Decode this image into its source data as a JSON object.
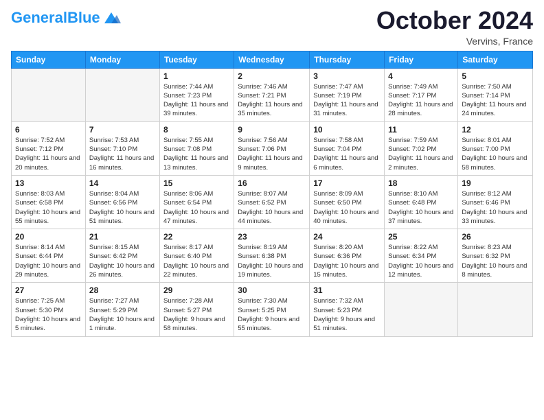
{
  "header": {
    "logo_text_general": "General",
    "logo_text_blue": "Blue",
    "month": "October 2024",
    "location": "Vervins, France"
  },
  "weekdays": [
    "Sunday",
    "Monday",
    "Tuesday",
    "Wednesday",
    "Thursday",
    "Friday",
    "Saturday"
  ],
  "weeks": [
    [
      {
        "day": "",
        "sunrise": "",
        "sunset": "",
        "daylight": ""
      },
      {
        "day": "",
        "sunrise": "",
        "sunset": "",
        "daylight": ""
      },
      {
        "day": "1",
        "sunrise": "Sunrise: 7:44 AM",
        "sunset": "Sunset: 7:23 PM",
        "daylight": "Daylight: 11 hours and 39 minutes."
      },
      {
        "day": "2",
        "sunrise": "Sunrise: 7:46 AM",
        "sunset": "Sunset: 7:21 PM",
        "daylight": "Daylight: 11 hours and 35 minutes."
      },
      {
        "day": "3",
        "sunrise": "Sunrise: 7:47 AM",
        "sunset": "Sunset: 7:19 PM",
        "daylight": "Daylight: 11 hours and 31 minutes."
      },
      {
        "day": "4",
        "sunrise": "Sunrise: 7:49 AM",
        "sunset": "Sunset: 7:17 PM",
        "daylight": "Daylight: 11 hours and 28 minutes."
      },
      {
        "day": "5",
        "sunrise": "Sunrise: 7:50 AM",
        "sunset": "Sunset: 7:14 PM",
        "daylight": "Daylight: 11 hours and 24 minutes."
      }
    ],
    [
      {
        "day": "6",
        "sunrise": "Sunrise: 7:52 AM",
        "sunset": "Sunset: 7:12 PM",
        "daylight": "Daylight: 11 hours and 20 minutes."
      },
      {
        "day": "7",
        "sunrise": "Sunrise: 7:53 AM",
        "sunset": "Sunset: 7:10 PM",
        "daylight": "Daylight: 11 hours and 16 minutes."
      },
      {
        "day": "8",
        "sunrise": "Sunrise: 7:55 AM",
        "sunset": "Sunset: 7:08 PM",
        "daylight": "Daylight: 11 hours and 13 minutes."
      },
      {
        "day": "9",
        "sunrise": "Sunrise: 7:56 AM",
        "sunset": "Sunset: 7:06 PM",
        "daylight": "Daylight: 11 hours and 9 minutes."
      },
      {
        "day": "10",
        "sunrise": "Sunrise: 7:58 AM",
        "sunset": "Sunset: 7:04 PM",
        "daylight": "Daylight: 11 hours and 6 minutes."
      },
      {
        "day": "11",
        "sunrise": "Sunrise: 7:59 AM",
        "sunset": "Sunset: 7:02 PM",
        "daylight": "Daylight: 11 hours and 2 minutes."
      },
      {
        "day": "12",
        "sunrise": "Sunrise: 8:01 AM",
        "sunset": "Sunset: 7:00 PM",
        "daylight": "Daylight: 10 hours and 58 minutes."
      }
    ],
    [
      {
        "day": "13",
        "sunrise": "Sunrise: 8:03 AM",
        "sunset": "Sunset: 6:58 PM",
        "daylight": "Daylight: 10 hours and 55 minutes."
      },
      {
        "day": "14",
        "sunrise": "Sunrise: 8:04 AM",
        "sunset": "Sunset: 6:56 PM",
        "daylight": "Daylight: 10 hours and 51 minutes."
      },
      {
        "day": "15",
        "sunrise": "Sunrise: 8:06 AM",
        "sunset": "Sunset: 6:54 PM",
        "daylight": "Daylight: 10 hours and 47 minutes."
      },
      {
        "day": "16",
        "sunrise": "Sunrise: 8:07 AM",
        "sunset": "Sunset: 6:52 PM",
        "daylight": "Daylight: 10 hours and 44 minutes."
      },
      {
        "day": "17",
        "sunrise": "Sunrise: 8:09 AM",
        "sunset": "Sunset: 6:50 PM",
        "daylight": "Daylight: 10 hours and 40 minutes."
      },
      {
        "day": "18",
        "sunrise": "Sunrise: 8:10 AM",
        "sunset": "Sunset: 6:48 PM",
        "daylight": "Daylight: 10 hours and 37 minutes."
      },
      {
        "day": "19",
        "sunrise": "Sunrise: 8:12 AM",
        "sunset": "Sunset: 6:46 PM",
        "daylight": "Daylight: 10 hours and 33 minutes."
      }
    ],
    [
      {
        "day": "20",
        "sunrise": "Sunrise: 8:14 AM",
        "sunset": "Sunset: 6:44 PM",
        "daylight": "Daylight: 10 hours and 29 minutes."
      },
      {
        "day": "21",
        "sunrise": "Sunrise: 8:15 AM",
        "sunset": "Sunset: 6:42 PM",
        "daylight": "Daylight: 10 hours and 26 minutes."
      },
      {
        "day": "22",
        "sunrise": "Sunrise: 8:17 AM",
        "sunset": "Sunset: 6:40 PM",
        "daylight": "Daylight: 10 hours and 22 minutes."
      },
      {
        "day": "23",
        "sunrise": "Sunrise: 8:19 AM",
        "sunset": "Sunset: 6:38 PM",
        "daylight": "Daylight: 10 hours and 19 minutes."
      },
      {
        "day": "24",
        "sunrise": "Sunrise: 8:20 AM",
        "sunset": "Sunset: 6:36 PM",
        "daylight": "Daylight: 10 hours and 15 minutes."
      },
      {
        "day": "25",
        "sunrise": "Sunrise: 8:22 AM",
        "sunset": "Sunset: 6:34 PM",
        "daylight": "Daylight: 10 hours and 12 minutes."
      },
      {
        "day": "26",
        "sunrise": "Sunrise: 8:23 AM",
        "sunset": "Sunset: 6:32 PM",
        "daylight": "Daylight: 10 hours and 8 minutes."
      }
    ],
    [
      {
        "day": "27",
        "sunrise": "Sunrise: 7:25 AM",
        "sunset": "Sunset: 5:30 PM",
        "daylight": "Daylight: 10 hours and 5 minutes."
      },
      {
        "day": "28",
        "sunrise": "Sunrise: 7:27 AM",
        "sunset": "Sunset: 5:29 PM",
        "daylight": "Daylight: 10 hours and 1 minute."
      },
      {
        "day": "29",
        "sunrise": "Sunrise: 7:28 AM",
        "sunset": "Sunset: 5:27 PM",
        "daylight": "Daylight: 9 hours and 58 minutes."
      },
      {
        "day": "30",
        "sunrise": "Sunrise: 7:30 AM",
        "sunset": "Sunset: 5:25 PM",
        "daylight": "Daylight: 9 hours and 55 minutes."
      },
      {
        "day": "31",
        "sunrise": "Sunrise: 7:32 AM",
        "sunset": "Sunset: 5:23 PM",
        "daylight": "Daylight: 9 hours and 51 minutes."
      },
      {
        "day": "",
        "sunrise": "",
        "sunset": "",
        "daylight": ""
      },
      {
        "day": "",
        "sunrise": "",
        "sunset": "",
        "daylight": ""
      }
    ]
  ]
}
